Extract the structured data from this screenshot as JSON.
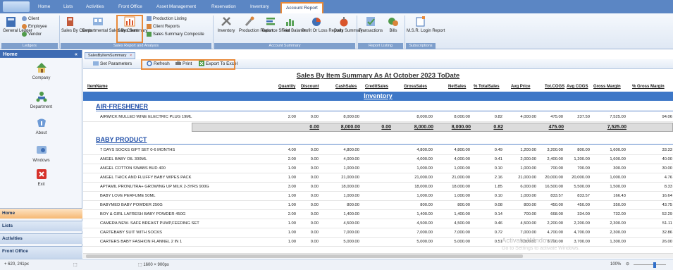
{
  "menu_tabs": [
    "Home",
    "Lists",
    "Activities",
    "Front Office",
    "Asset Management",
    "Reservation",
    "Inventory",
    "Account Report"
  ],
  "ribbon": {
    "ledgers": {
      "general_ledger": "General Ledger",
      "client": "Client",
      "employee": "Employee",
      "vendor": "Vendor",
      "group_label": "Ledgers"
    },
    "sales": {
      "sales_by_clients": "Sales By Clients",
      "departmental_sales_by_client": "Departmental Sales By Client",
      "sales_summary": "Sales Summary",
      "production_listing": "Production Listing",
      "client_reports": "Client Reports",
      "sales_summary_composite": "Sales Summary Composite",
      "group_label": "Sales Report and Analysis"
    },
    "account": {
      "inventory": "Inventory",
      "production_report": "Production Report",
      "balance_sheet": "Balance Sheet",
      "trial_balance": "Trial Balance",
      "profit_or_loss": "Profit Or Loss Reports",
      "daily_summary": "Daily Summary",
      "group_label": "Account Summary"
    },
    "listing": {
      "transactions": "Transactions",
      "bills": "Bills",
      "group_label": "Report Listing"
    },
    "subs": {
      "msr_login": "M.S.R. Login Report",
      "group_label": "Subscriptions"
    }
  },
  "sidebar": {
    "title": "Home",
    "collapse": "«",
    "items": [
      "Company",
      "Department",
      "About",
      "Windows",
      "Exit"
    ],
    "nav": [
      "Home",
      "Lists",
      "Activities",
      "Front Office"
    ]
  },
  "doc_tab": "SalesByItemSummary",
  "toolbar": {
    "set_parameters": "Set Parameters",
    "refresh": "Refresh",
    "print": "Print",
    "export": "Export To Excel"
  },
  "report": {
    "title": "Sales By Item Summary As At October 2023 ToDate",
    "headers": [
      "ItemName",
      "Quantity",
      "Discount",
      "CashSales",
      "CreditSales",
      "GrossSales",
      "NetSales",
      "% TotalSales",
      "Avg Price",
      "Tot.COGS",
      "Avg COGS",
      "Gross Margin",
      "% Gross Margin"
    ],
    "section": "Inventory",
    "categories": [
      {
        "name": "AIR-FRESHENER",
        "rows": [
          {
            "item": "AIRWICK MULLED WINE ELECTRIC PLUG 19ML",
            "qty": "2.00",
            "disc": "0.00",
            "cash": "8,000.00",
            "credit": "",
            "gross": "8,000.00",
            "net": "8,000.00",
            "pct": "0.82",
            "avg": "4,000.00",
            "cogs": "475.00",
            "avgcogs": "237.50",
            "margin": "7,525.00",
            "pctmargin": "94.06"
          }
        ],
        "subtotal": {
          "disc": "0.00",
          "cash": "8,000.00",
          "credit": "0.00",
          "gross": "8,000.00",
          "net": "8,000.00",
          "pct": "0.82",
          "cogs": "475.00",
          "margin": "7,525.00"
        }
      },
      {
        "name": "BABY PRODUCT",
        "rows": [
          {
            "item": "7 DAYS SOCKS GIFT SET 0-6 MONTHS",
            "qty": "4.00",
            "disc": "0.00",
            "cash": "4,800.00",
            "credit": "",
            "gross": "4,800.00",
            "net": "4,800.00",
            "pct": "0.49",
            "avg": "1,200.00",
            "cogs": "3,200.00",
            "avgcogs": "800.00",
            "margin": "1,600.00",
            "pctmargin": "33.33"
          },
          {
            "item": "ANGEL BABY OIL 300ML",
            "qty": "2.00",
            "disc": "0.00",
            "cash": "4,000.00",
            "credit": "",
            "gross": "4,000.00",
            "net": "4,000.00",
            "pct": "0.41",
            "avg": "2,000.00",
            "cogs": "2,400.00",
            "avgcogs": "1,200.00",
            "margin": "1,600.00",
            "pctmargin": "40.00"
          },
          {
            "item": "ANGEL COTTON SWABS BUD 400",
            "qty": "1.00",
            "disc": "0.00",
            "cash": "1,000.00",
            "credit": "",
            "gross": "1,000.00",
            "net": "1,000.00",
            "pct": "0.10",
            "avg": "1,000.00",
            "cogs": "700.00",
            "avgcogs": "700.00",
            "margin": "300.00",
            "pctmargin": "30.00"
          },
          {
            "item": "ANGEL THICK AND FLUFFY BABY WIPES PACK",
            "qty": "1.00",
            "disc": "0.00",
            "cash": "21,000.00",
            "credit": "",
            "gross": "21,000.00",
            "net": "21,000.00",
            "pct": "2.16",
            "avg": "21,000.00",
            "cogs": "20,000.00",
            "avgcogs": "20,000.00",
            "margin": "1,000.00",
            "pctmargin": "4.76"
          },
          {
            "item": "APTAMIL PRONUTRA+ GROWING UP MILK 2-3YRS 900G",
            "qty": "3.00",
            "disc": "0.00",
            "cash": "18,000.00",
            "credit": "",
            "gross": "18,000.00",
            "net": "18,000.00",
            "pct": "1.85",
            "avg": "6,000.00",
            "cogs": "16,500.00",
            "avgcogs": "5,500.00",
            "margin": "1,500.00",
            "pctmargin": "8.33"
          },
          {
            "item": "BABY LOVE PERFUME 50ML",
            "qty": "1.00",
            "disc": "0.00",
            "cash": "1,000.00",
            "credit": "",
            "gross": "1,000.00",
            "net": "1,000.00",
            "pct": "0.10",
            "avg": "1,000.00",
            "cogs": "833.57",
            "avgcogs": "833.57",
            "margin": "166.43",
            "pctmargin": "16.64"
          },
          {
            "item": "BABYMED BABY POWDER 250G",
            "qty": "1.00",
            "disc": "0.00",
            "cash": "800.00",
            "credit": "",
            "gross": "800.00",
            "net": "800.00",
            "pct": "0.08",
            "avg": "800.00",
            "cogs": "450.00",
            "avgcogs": "450.00",
            "margin": "350.00",
            "pctmargin": "43.75"
          },
          {
            "item": "BOY & GIRL LAFRESH BABY POWDER 450G",
            "qty": "2.00",
            "disc": "0.00",
            "cash": "1,400.00",
            "credit": "",
            "gross": "1,400.00",
            "net": "1,400.00",
            "pct": "0.14",
            "avg": "700.00",
            "cogs": "668.00",
            "avgcogs": "334.00",
            "margin": "732.00",
            "pctmargin": "52.29"
          },
          {
            "item": "CAMERA NEW- SAFE BREAST PUMP,FEEDING SET",
            "qty": "1.00",
            "disc": "0.00",
            "cash": "4,500.00",
            "credit": "",
            "gross": "4,500.00",
            "net": "4,500.00",
            "pct": "0.46",
            "avg": "4,500.00",
            "cogs": "2,200.00",
            "avgcogs": "2,200.00",
            "margin": "2,300.00",
            "pctmargin": "51.11"
          },
          {
            "item": "CARTEBABY SUIT WITH SOCKS",
            "qty": "1.00",
            "disc": "0.00",
            "cash": "7,000.00",
            "credit": "",
            "gross": "7,000.00",
            "net": "7,000.00",
            "pct": "0.72",
            "avg": "7,000.00",
            "cogs": "4,700.00",
            "avgcogs": "4,700.00",
            "margin": "2,300.00",
            "pctmargin": "32.86"
          },
          {
            "item": "CARTERS BABY FASHION FLANNEL 2 IN 1",
            "qty": "1.00",
            "disc": "0.00",
            "cash": "5,000.00",
            "credit": "",
            "gross": "5,000.00",
            "net": "5,000.00",
            "pct": "0.51",
            "avg": "5,000.00",
            "cogs": "3,700.00",
            "avgcogs": "3,700.00",
            "margin": "1,300.00",
            "pctmargin": "26.00"
          }
        ]
      }
    ]
  },
  "status": {
    "coords": "620, 241px",
    "size": "1600 × 900px",
    "zoom": "100%"
  },
  "watermark": {
    "line1": "Activate Windows",
    "line2": "Go to Settings to activate Windows."
  },
  "colors": {
    "highlight": "#e88a3a",
    "accent": "#3d77c7",
    "category": "#1f4ea8"
  }
}
